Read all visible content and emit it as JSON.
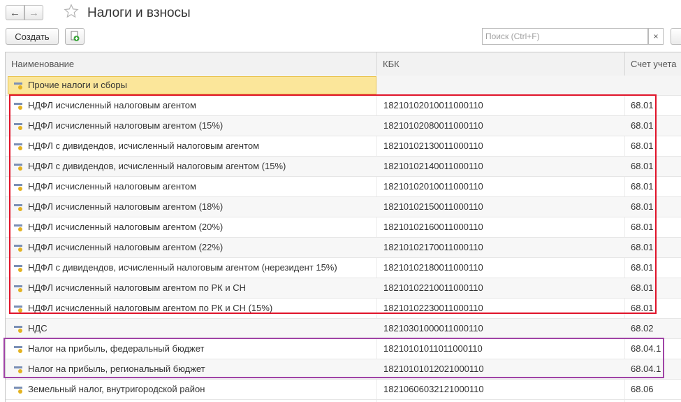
{
  "window": {
    "title": "Налоги и взносы"
  },
  "toolbar": {
    "create_label": "Создать",
    "search_placeholder": "Поиск (Ctrl+F)",
    "clear_label": "×"
  },
  "columns": {
    "name": "Наименование",
    "kbk": "КБК",
    "account": "Счет учета"
  },
  "group": {
    "name": "Прочие налоги и сборы"
  },
  "rows": [
    {
      "name": "НДФЛ исчисленный налоговым агентом",
      "kbk": "18210102010011000110",
      "account": "68.01"
    },
    {
      "name": "НДФЛ исчисленный налоговым агентом (15%)",
      "kbk": "18210102080011000110",
      "account": "68.01"
    },
    {
      "name": "НДФЛ с дивидендов, исчисленный налоговым агентом",
      "kbk": "18210102130011000110",
      "account": "68.01"
    },
    {
      "name": "НДФЛ с дивидендов, исчисленный налоговым агентом (15%)",
      "kbk": "18210102140011000110",
      "account": "68.01"
    },
    {
      "name": "НДФЛ исчисленный налоговым агентом",
      "kbk": "18210102010011000110",
      "account": "68.01"
    },
    {
      "name": "НДФЛ исчисленный налоговым агентом (18%)",
      "kbk": "18210102150011000110",
      "account": "68.01"
    },
    {
      "name": "НДФЛ исчисленный налоговым агентом (20%)",
      "kbk": "18210102160011000110",
      "account": "68.01"
    },
    {
      "name": "НДФЛ исчисленный налоговым агентом (22%)",
      "kbk": "18210102170011000110",
      "account": "68.01"
    },
    {
      "name": "НДФЛ с дивидендов, исчисленный налоговым агентом (нерезидент 15%)",
      "kbk": "18210102180011000110",
      "account": "68.01"
    },
    {
      "name": "НДФЛ исчисленный налоговым агентом по РК и СН",
      "kbk": "18210102210011000110",
      "account": "68.01"
    },
    {
      "name": "НДФЛ исчисленный налоговым агентом по РК и СН (15%)",
      "kbk": "18210102230011000110",
      "account": "68.01"
    },
    {
      "name": "НДС",
      "kbk": "18210301000011000110",
      "account": "68.02"
    },
    {
      "name": "Налог на прибыль, федеральный бюджет",
      "kbk": "18210101011011000110",
      "account": "68.04.1"
    },
    {
      "name": "Налог на прибыль, региональный бюджет",
      "kbk": "18210101012021000110",
      "account": "68.04.1"
    },
    {
      "name": "Земельный налог, внутригородской район",
      "kbk": "18210606032121000110",
      "account": "68.06"
    }
  ],
  "colors": {
    "highlight_red": "#e0142a",
    "highlight_purple": "#a044a6",
    "selection": "#fbe69a"
  }
}
